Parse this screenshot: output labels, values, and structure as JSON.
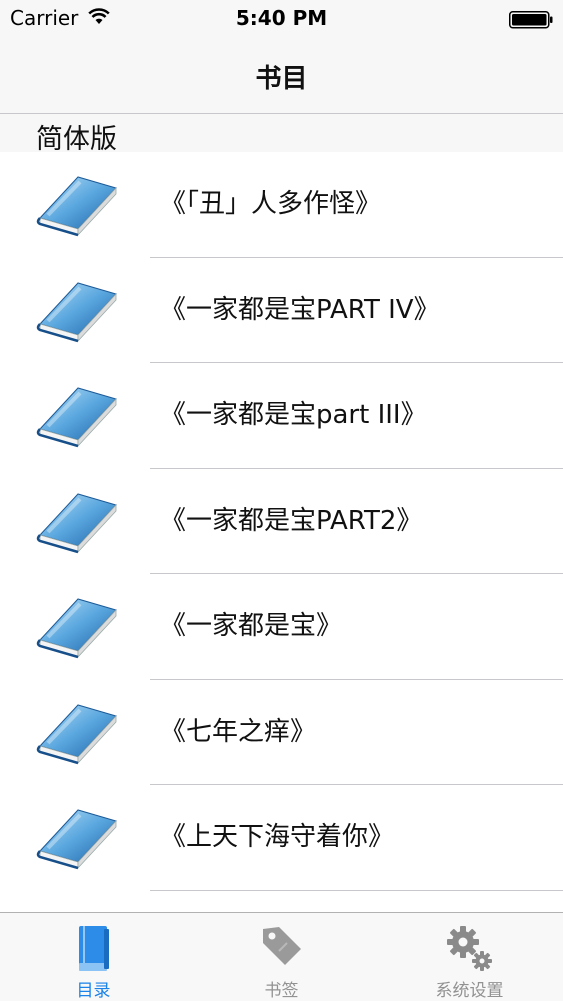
{
  "status_bar": {
    "carrier": "Carrier",
    "time": "5:40 PM"
  },
  "nav": {
    "title": "书目"
  },
  "section": {
    "label": "简体版"
  },
  "books": [
    {
      "title": "《「丑」人多作怪》"
    },
    {
      "title": "《一家都是宝PART IV》"
    },
    {
      "title": "《一家都是宝part III》"
    },
    {
      "title": "《一家都是宝PART2》"
    },
    {
      "title": "《一家都是宝》"
    },
    {
      "title": "《七年之痒》"
    },
    {
      "title": "《上天下海守着你》"
    }
  ],
  "tabs": [
    {
      "label": "目录",
      "icon": "book-icon",
      "active": true
    },
    {
      "label": "书签",
      "icon": "tag-icon",
      "active": false
    },
    {
      "label": "系统设置",
      "icon": "gear-icon",
      "active": false
    }
  ],
  "colors": {
    "accent": "#1a82e8",
    "inactive": "#929292",
    "separator": "#c8c7cc"
  }
}
